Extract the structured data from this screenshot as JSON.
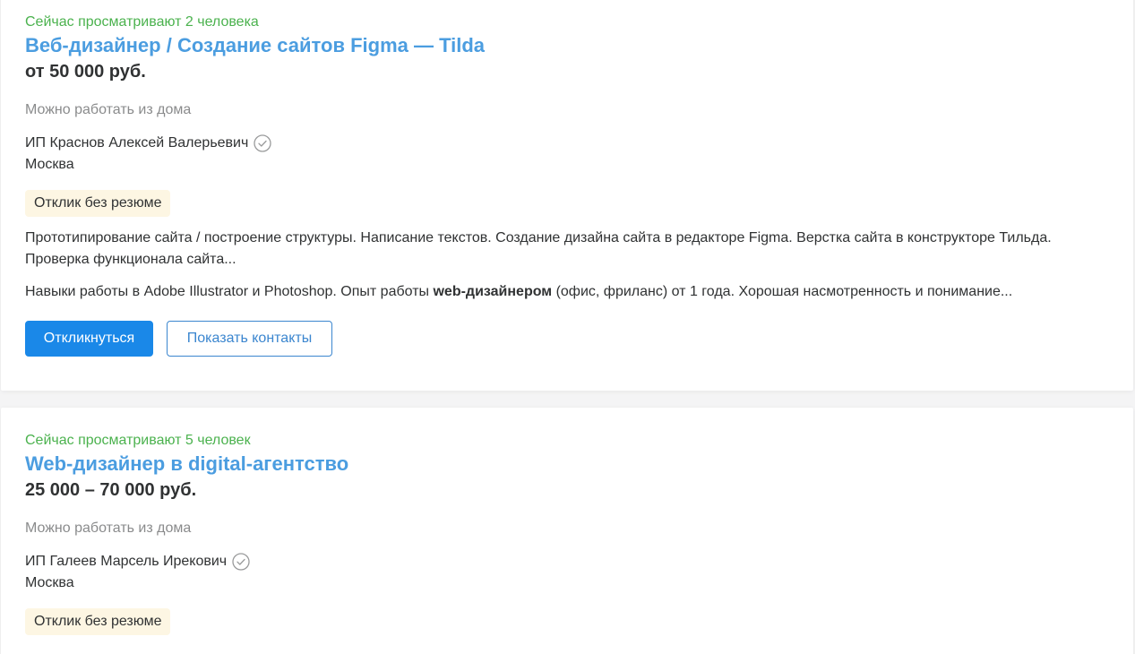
{
  "vacancies": [
    {
      "viewers": "Сейчас просматривают 2 человека",
      "title": "Веб-дизайнер / Создание сайтов Figma — Tilda",
      "salary": "от 50 000 руб.",
      "remote": "Можно работать из дома",
      "company": "ИП Краснов Алексей Валерьевич",
      "city": "Москва",
      "badge": "Отклик без резюме",
      "responsibilities": "Прототипирование сайта / построение структуры. Написание текстов. Создание дизайна сайта в редакторе Figma. Верстка сайта в конструкторе Тильда. Проверка функционала сайта...",
      "requirements_before": "Навыки работы в Adobe Illustrator и Photoshop. Опыт работы ",
      "requirements_highlight": "web-дизайнером",
      "requirements_after": " (офис, фриланс) от 1 года. Хорошая насмотренность и понимание...",
      "respond_label": "Откликнуться",
      "contacts_label": "Показать контакты"
    },
    {
      "viewers": "Сейчас просматривают 5 человек",
      "title": "Web-дизайнер в digital-агентство",
      "salary": "25 000 – 70 000 руб.",
      "remote": "Можно работать из дома",
      "company": "ИП Галеев Марсель Ирекович",
      "city": "Москва",
      "badge": "Отклик без резюме"
    }
  ],
  "colors": {
    "viewers_green": "#4bb24e",
    "title_blue": "#4b9de0",
    "primary_button": "#1a88e8",
    "badge_bg": "#fdf6e3"
  },
  "icons": {
    "verified": "check-circle-icon"
  }
}
